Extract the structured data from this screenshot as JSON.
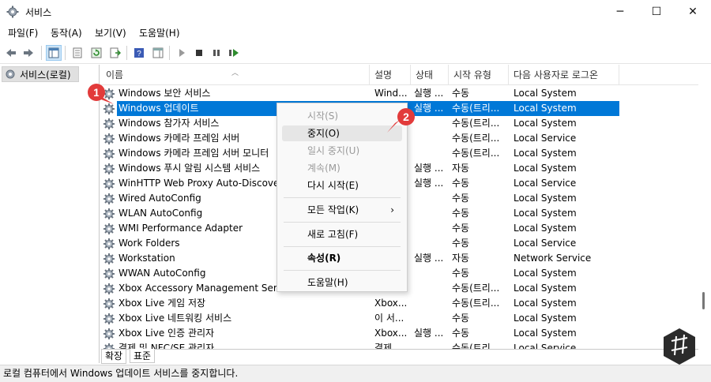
{
  "window": {
    "title": "서비스",
    "minimize": "─",
    "maximize": "☐",
    "close": "✕"
  },
  "menu": [
    "파일(F)",
    "동작(A)",
    "보기(V)",
    "도움말(H)"
  ],
  "tree": {
    "root_label": "서비스(로컬)"
  },
  "columns": {
    "name": "이름",
    "description": "설명",
    "status": "상태",
    "startup_type": "시작 유형",
    "logon_as": "다음 사용자로 로그온"
  },
  "services": [
    {
      "name": "Windows 보안 서비스",
      "description": "Wind...",
      "status": "실행 ...",
      "startup": "수동",
      "logon": "Local System"
    },
    {
      "name": "Windows 업데이트",
      "description": "",
      "status": "실행 ...",
      "startup": "수동(트리...",
      "logon": "Local System",
      "selected": true
    },
    {
      "name": "Windows 참가자 서비스",
      "description": "",
      "status": "",
      "startup": "수동(트리...",
      "logon": "Local System"
    },
    {
      "name": "Windows 카메라 프레임 서버",
      "description": "",
      "status": "",
      "startup": "수동(트리...",
      "logon": "Local Service"
    },
    {
      "name": "Windows 카메라 프레임 서버 모니터",
      "description": "",
      "status": "",
      "startup": "수동(트리...",
      "logon": "Local System"
    },
    {
      "name": "Windows 푸시 알림 시스템 서비스",
      "description": "",
      "status": "실행 ...",
      "startup": "자동",
      "logon": "Local System"
    },
    {
      "name": "WinHTTP Web Proxy Auto-Discovery",
      "description": "",
      "status": "실행 ...",
      "startup": "수동",
      "logon": "Local Service"
    },
    {
      "name": "Wired AutoConfig",
      "description": "",
      "status": "",
      "startup": "수동",
      "logon": "Local System"
    },
    {
      "name": "WLAN AutoConfig",
      "description": "",
      "status": "",
      "startup": "수동",
      "logon": "Local System"
    },
    {
      "name": "WMI Performance Adapter",
      "description": "",
      "status": "",
      "startup": "수동",
      "logon": "Local System"
    },
    {
      "name": "Work Folders",
      "description": "",
      "status": "",
      "startup": "수동",
      "logon": "Local Service"
    },
    {
      "name": "Workstation",
      "description": "",
      "status": "실행 ...",
      "startup": "자동",
      "logon": "Network Service"
    },
    {
      "name": "WWAN AutoConfig",
      "description": "",
      "status": "",
      "startup": "수동",
      "logon": "Local System"
    },
    {
      "name": "Xbox Accessory Management Service",
      "description": "",
      "status": "",
      "startup": "수동(트리...",
      "logon": "Local System"
    },
    {
      "name": "Xbox Live 게임 저장",
      "description": "Xbox...",
      "status": "",
      "startup": "수동(트리...",
      "logon": "Local System"
    },
    {
      "name": "Xbox Live 네트워킹 서비스",
      "description": "이 서...",
      "status": "",
      "startup": "수동",
      "logon": "Local System"
    },
    {
      "name": "Xbox Live 인증 관리자",
      "description": "Xbox...",
      "status": "실행 ...",
      "startup": "수동",
      "logon": "Local System"
    },
    {
      "name": "결제 및 NFC/SE 관리자",
      "description": "결제...",
      "status": "",
      "startup": "수동(트리...",
      "logon": "Local Service"
    }
  ],
  "context_menu": {
    "start": "시작(S)",
    "stop": "중지(O)",
    "pause": "일시 중지(U)",
    "resume": "계속(M)",
    "restart": "다시 시작(E)",
    "all_tasks": "모든 작업(K)",
    "all_tasks_arrow": "›",
    "refresh": "새로 고침(F)",
    "properties": "속성(R)",
    "help": "도움말(H)"
  },
  "tabs": [
    "확장",
    "표준"
  ],
  "status_bar": "로컬 컴퓨터에서 Windows 업데이트 서비스를 중지합니다.",
  "callouts": [
    "1",
    "2"
  ],
  "colors": {
    "selection": "#0078d7",
    "callout": "#e23b3b"
  }
}
